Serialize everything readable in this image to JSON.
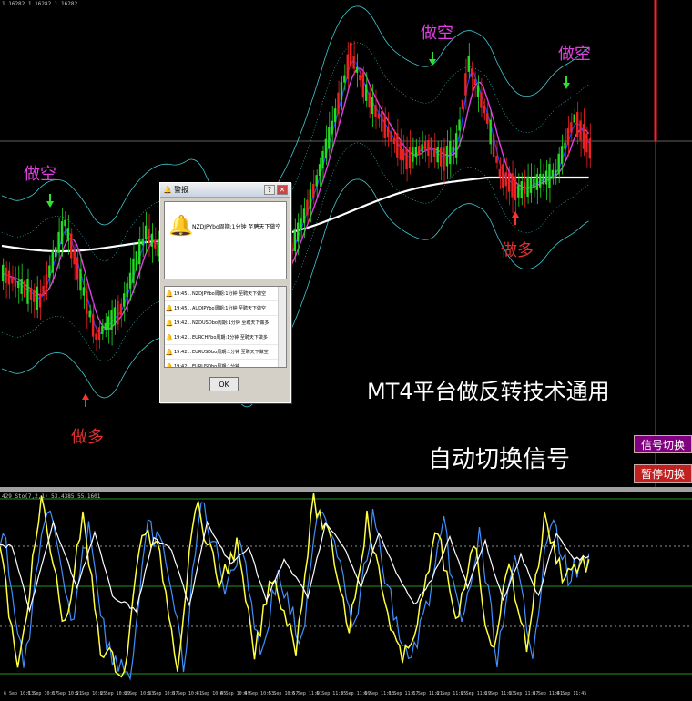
{
  "header": {
    "price_info": "1.16282 1.16282 1.16282"
  },
  "oscillator_header": {
    "text": "429 Sto(7,2,1) 53.4385 55.1601"
  },
  "signals": {
    "sell_1": "做空",
    "sell_2": "做空",
    "sell_3": "做空",
    "buy_1": "做多",
    "buy_2": "做多"
  },
  "banner": {
    "line1": "MT4平台做反转技术通用",
    "line2": "自动切换信号"
  },
  "buttons": {
    "signal_switch": "信号切换",
    "pause_switch": "暂停切换"
  },
  "dialog": {
    "title": "警报",
    "message": "NZDJPYbo周期:1分钟 至聘天下做空",
    "rows": [
      {
        "time": "19:45...",
        "text": "NZDJPYbo周期:1分钟 至聘天下做空"
      },
      {
        "time": "19:45...",
        "text": "AUDJPYbo周期:1分钟 至聘天下做空"
      },
      {
        "time": "19:42...",
        "text": "NZDUSDbo周期:1分钟 至聘天下做多"
      },
      {
        "time": "19:42...",
        "text": "EURCHFbo周期:1分钟 至聘天下做多"
      },
      {
        "time": "19:42...",
        "text": "EURUSDbo周期:1分钟 至聘天下做空"
      },
      {
        "time": "19:42...",
        "text": "EURUSDbo周期:1分钟 ..."
      }
    ],
    "ok_label": "OK"
  },
  "colors": {
    "background": "#000000",
    "bull_candle": "#22dd22",
    "bear_candle": "#ee2222",
    "band": "#40c8d0",
    "ma_white": "#ffffff",
    "ma_magenta": "#e040e0",
    "ma_blue": "#2040ff",
    "stoch_yellow": "#ffff40",
    "stoch_blue": "#4090ff",
    "stoch_white": "#ffffff",
    "level_green": "#30c030",
    "sell_text": "#e040e0",
    "buy_text": "#e03030",
    "button_signal": "#800080",
    "button_pause": "#c02020"
  },
  "time_axis": [
    "6 Sep 10:13",
    "6 Sep 10:17",
    "6 Sep 10:21",
    "6 Sep 10:25",
    "6 Sep 10:29",
    "6 Sep 10:33",
    "6 Sep 10:37",
    "6 Sep 10:41",
    "6 Sep 10:45",
    "6 Sep 10:49",
    "6 Sep 10:53",
    "6 Sep 10:57",
    "6 Sep 11:01",
    "6 Sep 11:05",
    "6 Sep 11:09",
    "6 Sep 11:13",
    "6 Sep 11:17",
    "6 Sep 11:21",
    "6 Sep 11:25",
    "6 Sep 11:29",
    "6 Sep 11:33",
    "6 Sep 11:37",
    "6 Sep 11:41",
    "6 Sep 11:45"
  ]
}
